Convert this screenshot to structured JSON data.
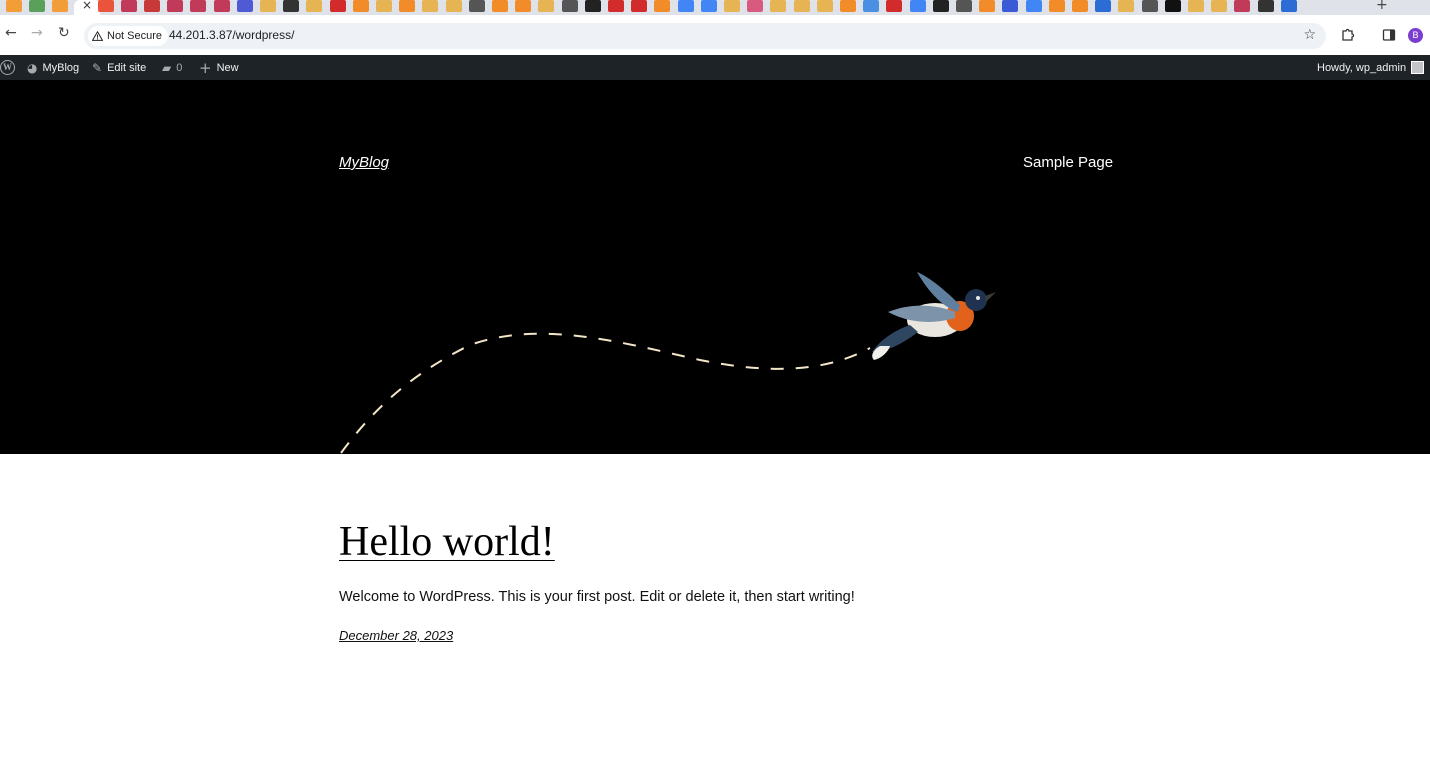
{
  "browser": {
    "security_label": "Not Secure",
    "url": "44.201.3.87/wordpress/",
    "profile_initial": "B",
    "tab_colors": [
      "#f29d38",
      "#5aa05a",
      "#f29d38",
      "#e9543b",
      "#c23a5a",
      "#c83a3a",
      "#c23a5a",
      "#c23a5a",
      "#c23a5a",
      "#4f5bd5",
      "#e6b452",
      "#333333",
      "#e6b452",
      "#d22b2b",
      "#f28c28",
      "#e6b452",
      "#f28c28",
      "#e6b452",
      "#e6b452",
      "#555555",
      "#f28c28",
      "#f28c28",
      "#e6b452",
      "#555555",
      "#222222",
      "#d22b2b",
      "#d22b2b",
      "#f28c28",
      "#4285f4",
      "#4285f4",
      "#e6b452",
      "#d85a7f",
      "#e6b452",
      "#e6b452",
      "#e6b452",
      "#f28c28",
      "#4a90e2",
      "#d22b2b",
      "#4285f4",
      "#222222",
      "#555555",
      "#f28c28",
      "#3a5bd5",
      "#4285f4",
      "#f28c28",
      "#f28c28",
      "#2b6cd5",
      "#e6b452",
      "#555555",
      "#111111",
      "#e6b452",
      "#e6b452",
      "#c23a5a",
      "#333333",
      "#2b6cd5"
    ]
  },
  "adminbar": {
    "site_name": "MyBlog",
    "edit_site": "Edit site",
    "comments_count": "0",
    "new_label": "New",
    "howdy": "Howdy, wp_admin"
  },
  "header": {
    "site_title": "MyBlog",
    "nav": [
      "Sample Page"
    ]
  },
  "post": {
    "title": "Hello world!",
    "excerpt": "Welcome to WordPress. This is your first post. Edit or delete it, then start writing!",
    "date": "December 28, 2023"
  }
}
